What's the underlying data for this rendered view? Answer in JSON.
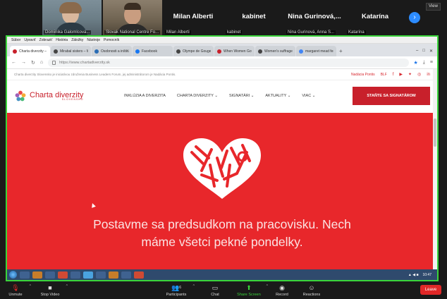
{
  "participants": [
    {
      "name": "Dominika Galomlcová..."
    },
    {
      "name": "Slovak National Centre Fo..."
    },
    {
      "name": "Milan Alberti",
      "label": "Milan Alberti"
    },
    {
      "name": "kabinet",
      "label": "kabinet"
    },
    {
      "name": "Nina Gurinová, Anna S...",
      "label": "Nina Gurinová,..."
    },
    {
      "name": "Katarína",
      "label": "Katarína"
    }
  ],
  "view_label": "View",
  "browser": {
    "menu": [
      "Súbor",
      "Upraviť",
      "Zobraziť",
      "História",
      "Záložky",
      "Nástroje",
      "Pomocník"
    ],
    "tabs": [
      "Charta diverzity – ...",
      "Mirabal sisters – Wi...",
      "Osobnosti a inštitúc...",
      "Facebook",
      "Olympe de Gouges",
      "When Women Got...",
      "Women's suffrage",
      "margaret mead femi..."
    ],
    "url": "https://www.chartadiverzity.sk"
  },
  "site": {
    "info": "Charta diverzity Slovensko je iniciatívou združenia Business Leaders Forum, jej administrátorom je Nadácia Pontis.",
    "top_links": [
      "Nadácia Pontis",
      "BLF"
    ],
    "logo_text": "Charta diverzity",
    "logo_sub": "SLOVENSKO",
    "nav": [
      "INKLÚZIA A DIVERZITA",
      "CHARTA DIVERZITY ⌄",
      "SIGNATÁRI ⌄",
      "AKTUALITY ⌄",
      "VIAC ⌄"
    ],
    "cta": "STAŇTE SA SIGNATÁROM",
    "hero_line1": "Postavme sa predsudkom na pracovisku. Nech",
    "hero_line2": "máme všetci pekné pondelky."
  },
  "taskbar": {
    "time": "10:47"
  },
  "toolbar": {
    "unmute": "Unmute",
    "stop_video": "Stop Video",
    "participants": "Participants",
    "participants_count": "6",
    "chat": "Chat",
    "share_screen": "Share Screen",
    "record": "Record",
    "reactions": "Reactions",
    "leave": "Leave"
  },
  "colors": {
    "accent": "#2d8cff",
    "brand_red": "#e8272b",
    "share_border": "#3ad43a",
    "leave": "#e02828"
  }
}
